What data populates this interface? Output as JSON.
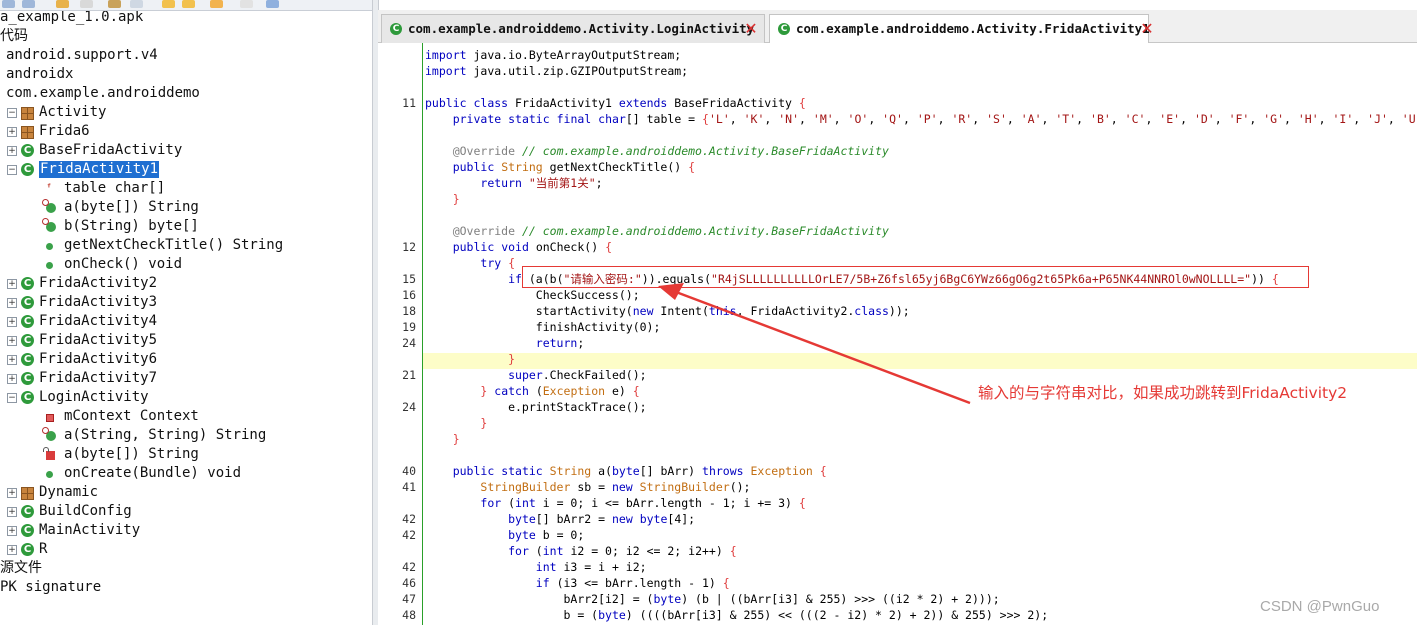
{
  "tree": [
    {
      "label": "a_example_1.0.apk",
      "icon": "none"
    },
    {
      "label": "代码",
      "icon": "none"
    },
    {
      "label": "android.support.v4",
      "icon": "package-icon"
    },
    {
      "label": "androidx",
      "icon": "package-icon"
    },
    {
      "label": "com.example.androiddemo",
      "icon": "package-icon"
    },
    {
      "label": "Activity",
      "icon": "package-icon",
      "expander": "⊟"
    },
    {
      "label": "Frida6",
      "icon": "package-icon",
      "expander": "⊞"
    },
    {
      "label": "BaseFridaActivity",
      "icon": "class-icon",
      "expander": "⊞"
    },
    {
      "label": "FridaActivity1",
      "icon": "class-icon",
      "expander": "⊟",
      "selected": true
    },
    {
      "label": "table char[]",
      "icon": "field-icon"
    },
    {
      "label": "a(byte[]) String",
      "icon": "static-method-icon"
    },
    {
      "label": "b(String) byte[]",
      "icon": "static-method-icon"
    },
    {
      "label": "getNextCheckTitle() String",
      "icon": "method-icon"
    },
    {
      "label": "onCheck() void",
      "icon": "method-icon"
    },
    {
      "label": "FridaActivity2",
      "icon": "class-icon",
      "expander": "⊞"
    },
    {
      "label": "FridaActivity3",
      "icon": "class-icon",
      "expander": "⊞"
    },
    {
      "label": "FridaActivity4",
      "icon": "class-icon",
      "expander": "⊞"
    },
    {
      "label": "FridaActivity5",
      "icon": "class-icon",
      "expander": "⊞"
    },
    {
      "label": "FridaActivity6",
      "icon": "class-icon",
      "expander": "⊞"
    },
    {
      "label": "FridaActivity7",
      "icon": "class-icon",
      "expander": "⊞"
    },
    {
      "label": "LoginActivity",
      "icon": "class-icon",
      "expander": "⊟"
    },
    {
      "label": "mContext Context",
      "icon": "private-field-icon"
    },
    {
      "label": "a(String, String) String",
      "icon": "static-method-icon"
    },
    {
      "label": "a(byte[]) String",
      "icon": "private-static-method-icon"
    },
    {
      "label": "onCreate(Bundle) void",
      "icon": "method-icon"
    },
    {
      "label": "Dynamic",
      "icon": "package-icon",
      "expander": "⊞"
    },
    {
      "label": "BuildConfig",
      "icon": "class-icon",
      "expander": "⊞"
    },
    {
      "label": "MainActivity",
      "icon": "class-icon",
      "expander": "⊞"
    },
    {
      "label": "R",
      "icon": "class-icon",
      "expander": "⊞"
    },
    {
      "label": "源文件",
      "icon": "none"
    },
    {
      "label": "PK signature",
      "icon": "none"
    }
  ],
  "tabs": [
    {
      "label": "com.example.androiddemo.Activity.LoginActivity",
      "active": false
    },
    {
      "label": "com.example.androiddemo.Activity.FridaActivity1",
      "active": true
    }
  ],
  "code": [
    {
      "ln": "",
      "text": "import java.io.ByteArrayOutputStream;"
    },
    {
      "ln": "",
      "text": "import java.util.zip.GZIPOutputStream;"
    },
    {
      "ln": "",
      "text": ""
    },
    {
      "ln": "11",
      "text": "public class FridaActivity1 extends BaseFridaActivity {"
    },
    {
      "ln": "",
      "text": "    private static final char[] table = {'L', 'K', 'N', 'M', 'O', 'Q', 'P', 'R', 'S', 'A', 'T', 'B', 'C', 'E', 'D', 'F', 'G', 'H', 'I', 'J', 'U',"
    },
    {
      "ln": "",
      "text": ""
    },
    {
      "ln": "",
      "text": "    @Override // com.example.androiddemo.Activity.BaseFridaActivity"
    },
    {
      "ln": "",
      "text": "    public String getNextCheckTitle() {"
    },
    {
      "ln": "",
      "text": "        return \"当前第1关\";"
    },
    {
      "ln": "",
      "text": "    }"
    },
    {
      "ln": "",
      "text": ""
    },
    {
      "ln": "",
      "text": "    @Override // com.example.androiddemo.Activity.BaseFridaActivity"
    },
    {
      "ln": "12",
      "text": "    public void onCheck() {"
    },
    {
      "ln": "",
      "text": "        try {"
    },
    {
      "ln": "15",
      "text": "            if (a(b(\"请输入密码:\")).equals(\"R4jSLLLLLLLLLLOrLE7/5B+Z6fsl65yj6BgC6YWz66gO6g2t65Pk6a+P65NK44NNROl0wNOLLLL=\")) {"
    },
    {
      "ln": "16",
      "text": "                CheckSuccess();"
    },
    {
      "ln": "18",
      "text": "                startActivity(new Intent(this, FridaActivity2.class));"
    },
    {
      "ln": "19",
      "text": "                finishActivity(0);"
    },
    {
      "ln": "24",
      "text": "                return;"
    },
    {
      "ln": "",
      "text": "            }"
    },
    {
      "ln": "21",
      "text": "            super.CheckFailed();"
    },
    {
      "ln": "",
      "text": "        } catch (Exception e) {"
    },
    {
      "ln": "24",
      "text": "            e.printStackTrace();"
    },
    {
      "ln": "",
      "text": "        }"
    },
    {
      "ln": "",
      "text": "    }"
    },
    {
      "ln": "",
      "text": ""
    },
    {
      "ln": "40",
      "text": "    public static String a(byte[] bArr) throws Exception {"
    },
    {
      "ln": "41",
      "text": "        StringBuilder sb = new StringBuilder();"
    },
    {
      "ln": "",
      "text": "        for (int i = 0; i <= bArr.length - 1; i += 3) {"
    },
    {
      "ln": "42",
      "text": "            byte[] bArr2 = new byte[4];"
    },
    {
      "ln": "42",
      "text": "            byte b = 0;"
    },
    {
      "ln": "",
      "text": "            for (int i2 = 0; i2 <= 2; i2++) {"
    },
    {
      "ln": "42",
      "text": "                int i3 = i + i2;"
    },
    {
      "ln": "46",
      "text": "                if (i3 <= bArr.length - 1) {"
    },
    {
      "ln": "47",
      "text": "                    bArr2[i2] = (byte) (b | ((bArr[i3] & 255) >>> ((i2 * 2) + 2)));"
    },
    {
      "ln": "48",
      "text": "                    b = (byte) ((((bArr[i3] & 255) << (((2 - i2) * 2) + 2)) & 255) >>> 2);"
    }
  ],
  "annotation": "输入的与字符串对比，如果成功跳转到FridaActivity2",
  "watermark": "CSDN @PwnGuo",
  "colors": {
    "keyword": "#0000c0",
    "string": "#a31515",
    "comment": "#2a8a2a",
    "annotation_red": "#e53935",
    "selection": "#1f6fd1",
    "highlight_line": "#fdfdc8"
  }
}
